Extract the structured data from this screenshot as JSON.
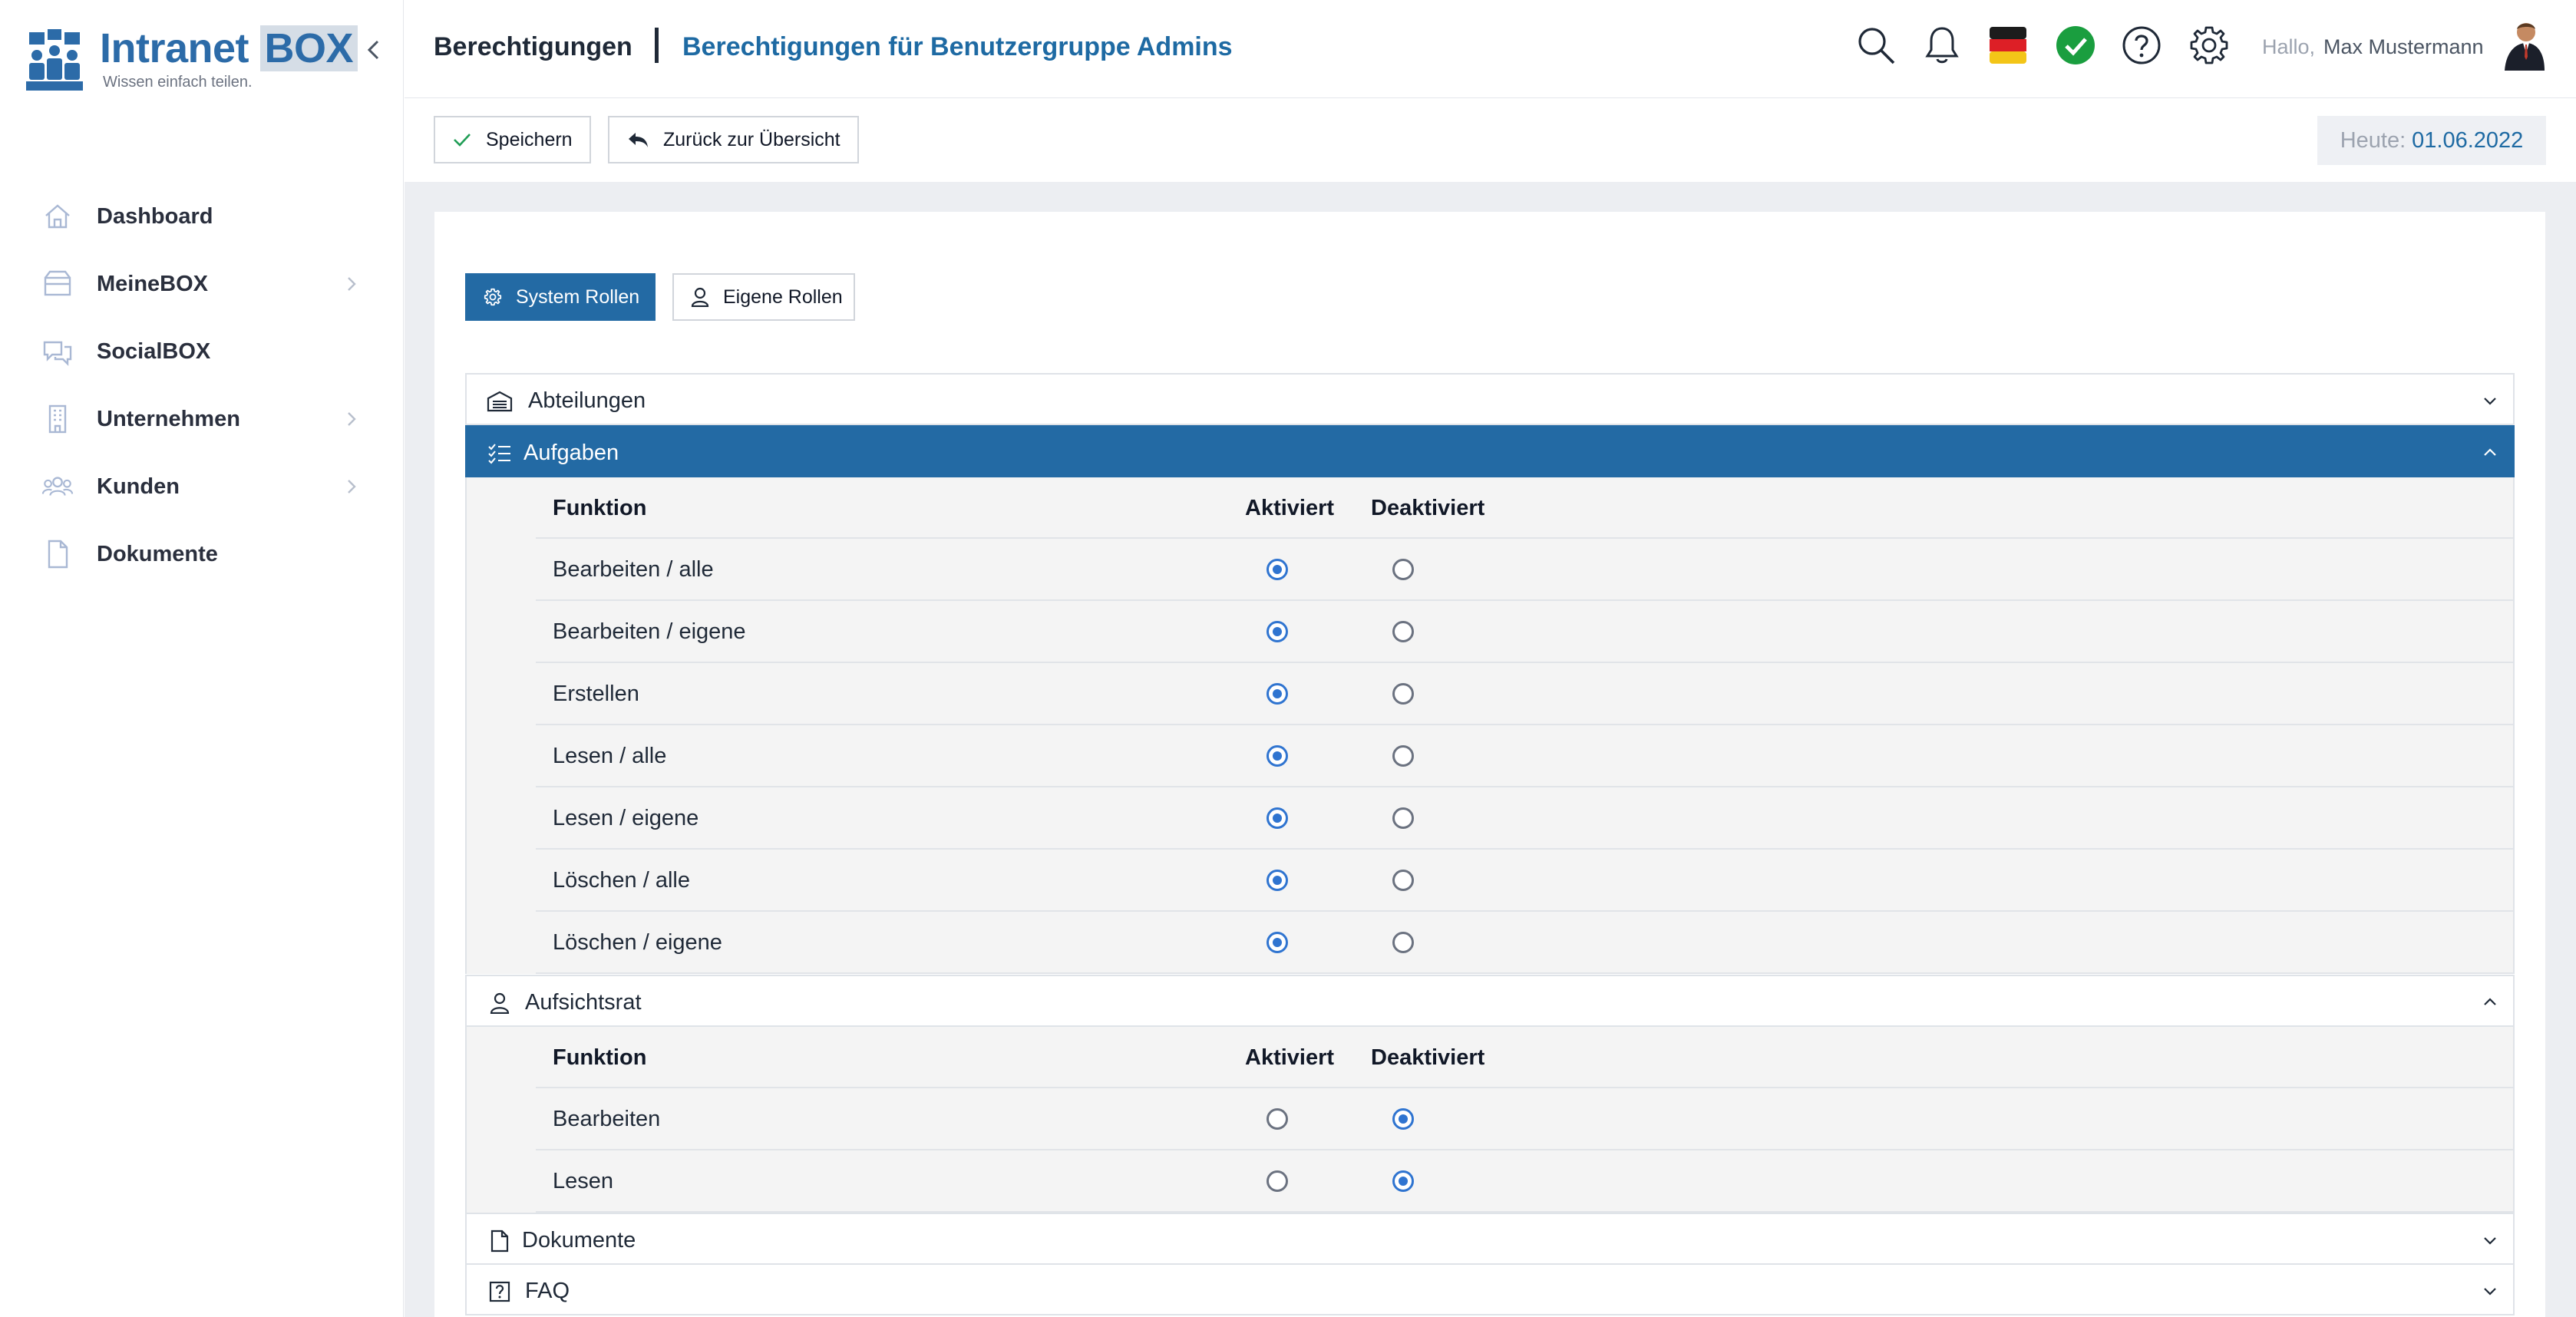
{
  "brand": {
    "name": "Intranet",
    "name_box": "BOX",
    "tagline": "Wissen einfach teilen."
  },
  "sidebar": {
    "items": [
      {
        "label": "Dashboard",
        "icon": "home-icon",
        "has_submenu": false
      },
      {
        "label": "MeineBOX",
        "icon": "box-icon",
        "has_submenu": true
      },
      {
        "label": "SocialBOX",
        "icon": "chat-bubbles-icon",
        "has_submenu": false
      },
      {
        "label": "Unternehmen",
        "icon": "building-icon",
        "has_submenu": true
      },
      {
        "label": "Kunden",
        "icon": "users-icon",
        "has_submenu": true
      },
      {
        "label": "Dokumente",
        "icon": "document-icon",
        "has_submenu": false
      }
    ]
  },
  "header": {
    "title": "Berechtigungen",
    "subtitle": "Berechtigungen für Benutzergruppe Admins",
    "icons": [
      "search-icon",
      "bell-icon",
      "german-flag-icon",
      "status-check-icon",
      "help-icon",
      "gear-icon"
    ],
    "greeting": "Hallo,",
    "user_name": "Max Mustermann"
  },
  "toolbar": {
    "save_label": "Speichern",
    "back_label": "Zurück zur Übersicht",
    "today_label": "Heute:",
    "today_value": "01.06.2022"
  },
  "roles": {
    "system_label": "System Rollen",
    "own_label": "Eigene Rollen",
    "active": "system"
  },
  "columns": {
    "function": "Funktion",
    "activated": "Aktiviert",
    "deactivated": "Deaktiviert"
  },
  "sections": {
    "abteilungen": {
      "title": "Abteilungen",
      "expanded": false
    },
    "aufgaben": {
      "title": "Aufgaben",
      "expanded": true,
      "rows": [
        {
          "label": "Bearbeiten / alle",
          "activated": true
        },
        {
          "label": "Bearbeiten / eigene",
          "activated": true
        },
        {
          "label": "Erstellen",
          "activated": true
        },
        {
          "label": "Lesen / alle",
          "activated": true
        },
        {
          "label": "Lesen / eigene",
          "activated": true
        },
        {
          "label": "Löschen / alle",
          "activated": true
        },
        {
          "label": "Löschen / eigene",
          "activated": true
        }
      ]
    },
    "aufsichtsrat": {
      "title": "Aufsichtsrat",
      "expanded": true,
      "rows": [
        {
          "label": "Bearbeiten",
          "activated": false
        },
        {
          "label": "Lesen",
          "activated": false
        }
      ]
    },
    "dokumente": {
      "title": "Dokumente",
      "expanded": false
    },
    "faq": {
      "title": "FAQ",
      "expanded": false
    }
  },
  "colors": {
    "primary": "#236aa4",
    "radio_on": "#2f74d0",
    "status_green": "#1a9e3f"
  }
}
